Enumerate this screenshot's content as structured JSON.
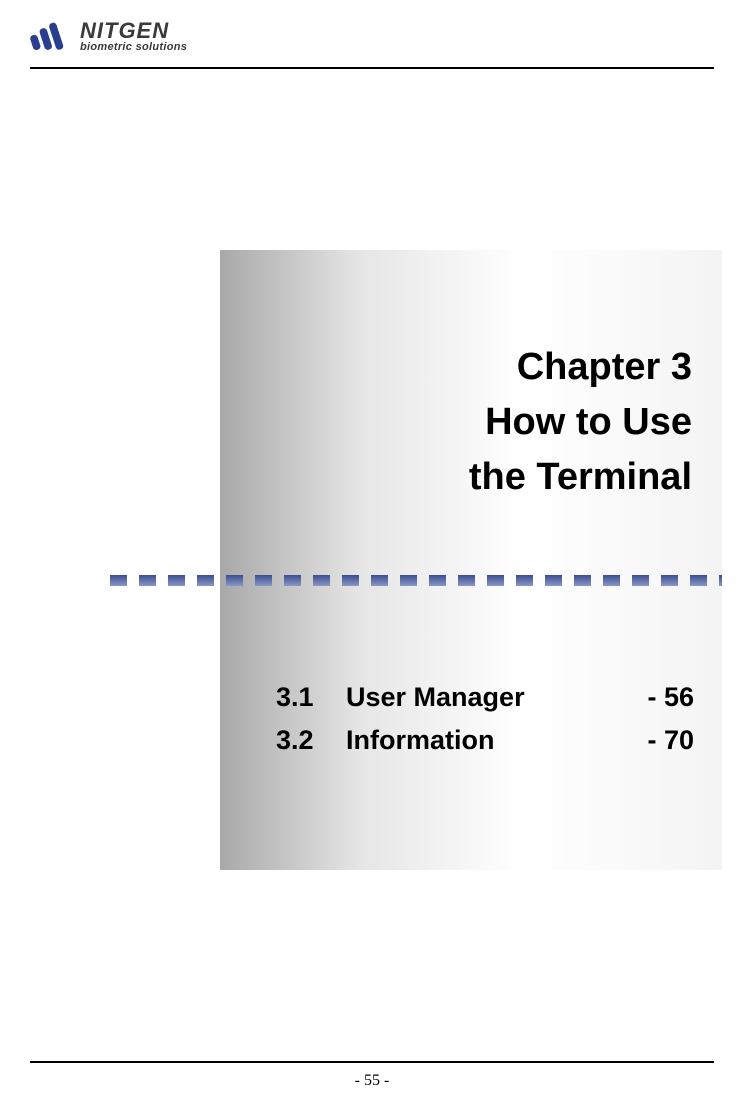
{
  "brand": {
    "name": "NITGEN",
    "tagline": "biometric solutions"
  },
  "chapter": {
    "line1": "Chapter 3",
    "line2": "How to Use",
    "line3": "the Terminal"
  },
  "toc": [
    {
      "num": "3.1",
      "label": "User Manager",
      "page": "- 56"
    },
    {
      "num": "3.2",
      "label": "Information",
      "page": "- 70"
    }
  ],
  "page_number": "- 55 -"
}
